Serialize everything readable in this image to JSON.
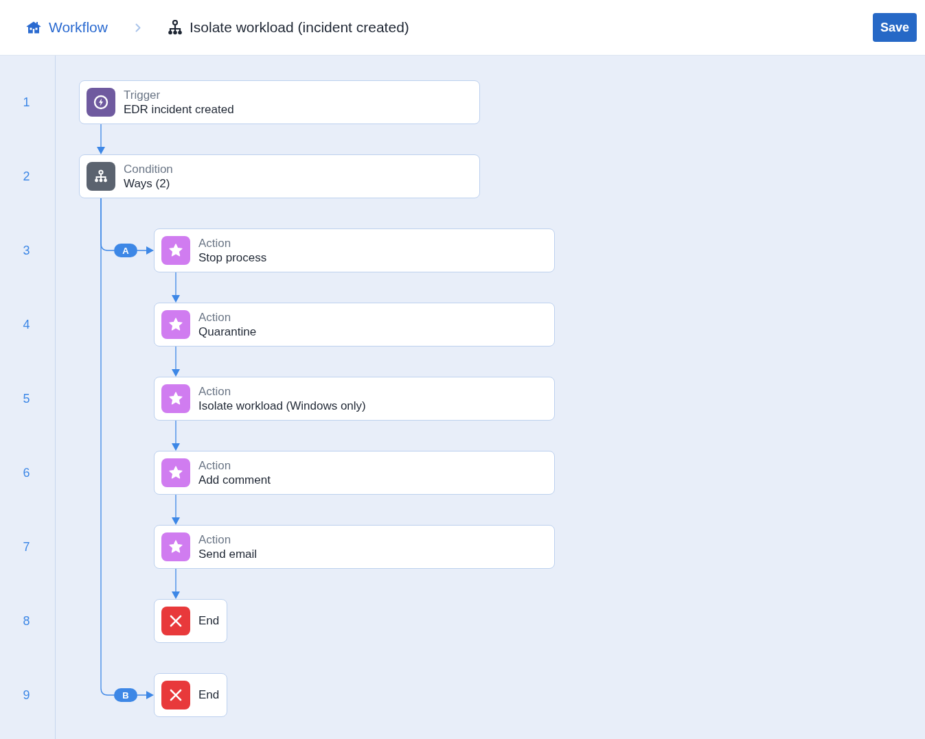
{
  "header": {
    "breadcrumb_link": "Workflow",
    "title": "Isolate workload (incident created)",
    "save_button": "Save"
  },
  "line_numbers": [
    "1",
    "2",
    "3",
    "4",
    "5",
    "6",
    "7",
    "8",
    "9"
  ],
  "steps": [
    {
      "kind": "trigger",
      "label": "Trigger",
      "value": "EDR incident created"
    },
    {
      "kind": "condition",
      "label": "Condition",
      "value": "Ways (2)",
      "branches": [
        {
          "badge": "A",
          "steps": [
            {
              "kind": "action",
              "label": "Action",
              "value": "Stop process"
            },
            {
              "kind": "action",
              "label": "Action",
              "value": "Quarantine"
            },
            {
              "kind": "action",
              "label": "Action",
              "value": "Isolate workload (Windows only)"
            },
            {
              "kind": "action",
              "label": "Action",
              "value": "Add comment"
            },
            {
              "kind": "action",
              "label": "Action",
              "value": "Send email"
            },
            {
              "kind": "end",
              "value": "End"
            }
          ]
        },
        {
          "badge": "B",
          "steps": [
            {
              "kind": "end",
              "value": "End"
            }
          ]
        }
      ]
    }
  ]
}
